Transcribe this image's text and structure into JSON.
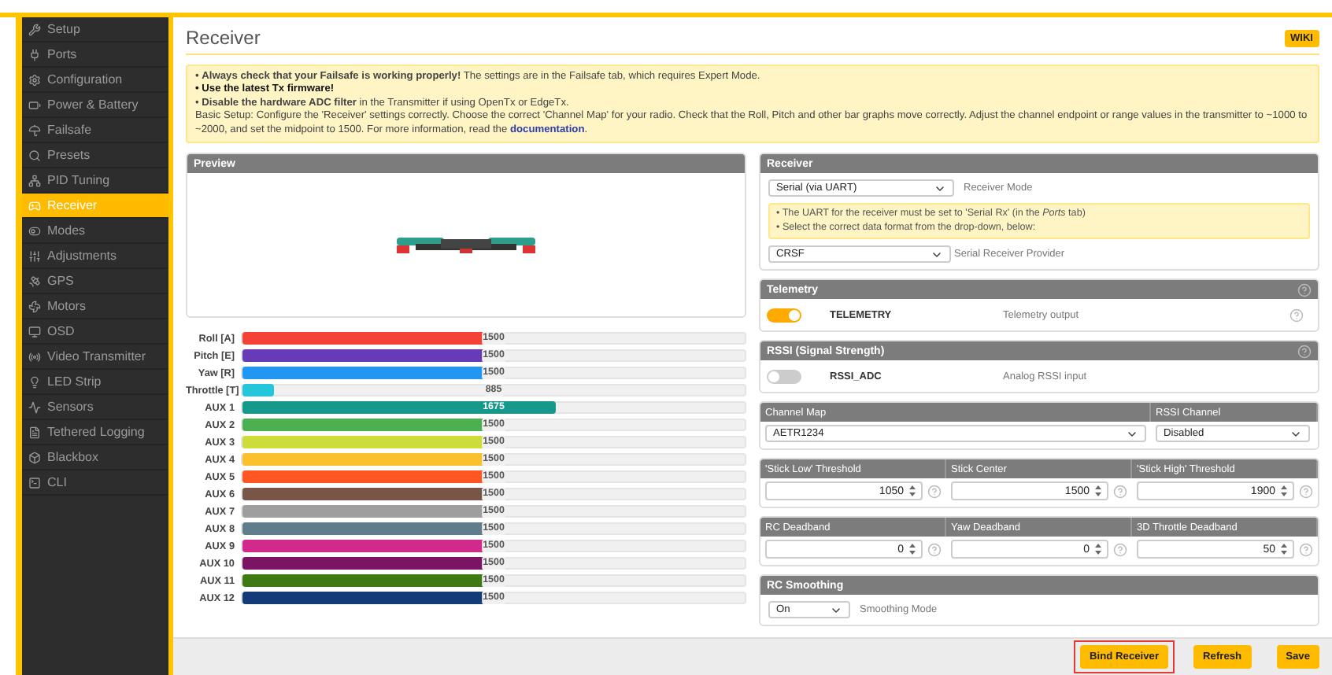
{
  "sidebar": {
    "items": [
      {
        "label": "Setup",
        "selected": false
      },
      {
        "label": "Ports",
        "selected": false
      },
      {
        "label": "Configuration",
        "selected": false
      },
      {
        "label": "Power & Battery",
        "selected": false
      },
      {
        "label": "Failsafe",
        "selected": false
      },
      {
        "label": "Presets",
        "selected": false
      },
      {
        "label": "PID Tuning",
        "selected": false
      },
      {
        "label": "Receiver",
        "selected": true
      },
      {
        "label": "Modes",
        "selected": false
      },
      {
        "label": "Adjustments",
        "selected": false
      },
      {
        "label": "GPS",
        "selected": false
      },
      {
        "label": "Motors",
        "selected": false
      },
      {
        "label": "OSD",
        "selected": false
      },
      {
        "label": "Video Transmitter",
        "selected": false
      },
      {
        "label": "LED Strip",
        "selected": false
      },
      {
        "label": "Sensors",
        "selected": false
      },
      {
        "label": "Tethered Logging",
        "selected": false
      },
      {
        "label": "Blackbox",
        "selected": false
      },
      {
        "label": "CLI",
        "selected": false
      }
    ]
  },
  "header": {
    "title": "Receiver",
    "wiki_button": "WIKI"
  },
  "notice": {
    "lines": [
      {
        "kind": "mixed",
        "text": "• **Always check that your Failsafe is working properly!** The settings are in the Failsafe tab, which requires Expert Mode."
      },
      {
        "kind": "bold",
        "text": "• Use the latest Tx firmware!"
      },
      {
        "kind": "mixed",
        "text": "• **Disable the hardware ADC filter** in the Transmitter if using OpenTx or EdgeTx."
      },
      {
        "kind": "link",
        "text": "Basic Setup: Configure the 'Receiver' settings correctly. Choose the correct 'Channel Map' for your radio. Check that the Roll, Pitch and other bar graphs move correctly. Adjust the channel endpoint or range values in the transmitter to ~1000 to ~2000, and set the midpoint to 1500. For more information, read the",
        "link": "documentation",
        "after": "."
      }
    ]
  },
  "preview": {
    "title": "Preview"
  },
  "channels": [
    {
      "label": "Roll [A]",
      "color": "#f44336",
      "value": "1500",
      "level": 0.5
    },
    {
      "label": "Pitch [E]",
      "color": "#673ab7",
      "value": "1500",
      "level": 0.5
    },
    {
      "label": "Yaw [R]",
      "color": "#2196f3",
      "value": "1500",
      "level": 0.5
    },
    {
      "label": "Throttle [T]",
      "color": "#26c6da",
      "value": "885",
      "level": 0.062
    },
    {
      "label": "AUX 1",
      "color": "#16988a",
      "value": "1675",
      "level": 0.625
    },
    {
      "label": "AUX 2",
      "color": "#4caf50",
      "value": "1500",
      "level": 0.5
    },
    {
      "label": "AUX 3",
      "color": "#cddc39",
      "value": "1500",
      "level": 0.5
    },
    {
      "label": "AUX 4",
      "color": "#fbc02d",
      "value": "1500",
      "level": 0.5
    },
    {
      "label": "AUX 5",
      "color": "#ff5722",
      "value": "1500",
      "level": 0.5
    },
    {
      "label": "AUX 6",
      "color": "#795548",
      "value": "1500",
      "level": 0.5
    },
    {
      "label": "AUX 7",
      "color": "#9e9e9e",
      "value": "1500",
      "level": 0.5
    },
    {
      "label": "AUX 8",
      "color": "#607d8b",
      "value": "1500",
      "level": 0.5
    },
    {
      "label": "AUX 9",
      "color": "#d12a8c",
      "value": "1500",
      "level": 0.5
    },
    {
      "label": "AUX 10",
      "color": "#7b1462",
      "value": "1500",
      "level": 0.5
    },
    {
      "label": "AUX 11",
      "color": "#3d7a14",
      "value": "1500",
      "level": 0.5
    },
    {
      "label": "AUX 12",
      "color": "#123b78",
      "value": "1500",
      "level": 0.5
    }
  ],
  "receiver": {
    "title": "Receiver",
    "mode": "Serial (via UART)",
    "mode_label": "Receiver Mode",
    "note": [
      "• The UART for the receiver must be set to 'Serial Rx' (in the *Ports* tab)",
      "• Select the correct data format from the drop-down, below:"
    ],
    "provider": "CRSF",
    "provider_label": "Serial Receiver Provider"
  },
  "telemetry": {
    "title": "Telemetry",
    "on": true,
    "name": "TELEMETRY",
    "description": "Telemetry output"
  },
  "rssi": {
    "title": "RSSI (Signal Strength)",
    "on": false,
    "name": "RSSI_ADC",
    "description": "Analog RSSI input"
  },
  "channel_map": {
    "label": "Channel Map",
    "value": "AETR1234",
    "rssi_label": "RSSI Channel",
    "rssi_value": "Disabled"
  },
  "thresholds": [
    {
      "label": "'Stick Low' Threshold",
      "value": "1050"
    },
    {
      "label": "Stick Center",
      "value": "1500"
    },
    {
      "label": "'Stick High' Threshold",
      "value": "1900"
    }
  ],
  "deadbands": [
    {
      "label": "RC Deadband",
      "value": "0"
    },
    {
      "label": "Yaw Deadband",
      "value": "0"
    },
    {
      "label": "3D Throttle Deadband",
      "value": "50"
    }
  ],
  "smoothing": {
    "title": "RC Smoothing",
    "mode": "On",
    "mode_label": "Smoothing Mode"
  },
  "footer": {
    "buttons": [
      {
        "label": "Bind Receiver",
        "highlighted": true
      },
      {
        "label": "Refresh",
        "highlighted": false
      },
      {
        "label": "Save",
        "highlighted": false
      }
    ]
  }
}
